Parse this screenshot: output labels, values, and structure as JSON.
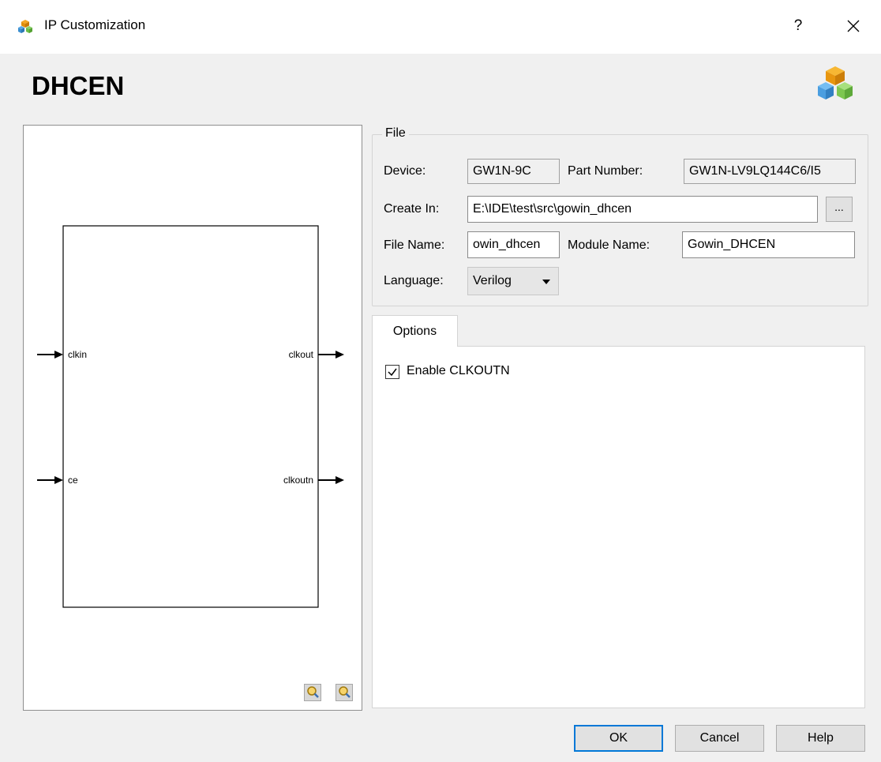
{
  "window": {
    "title": "IP Customization",
    "help_label": "?"
  },
  "heading": "DHCEN",
  "preview": {
    "ports_left": [
      "clkin",
      "ce"
    ],
    "ports_right": [
      "clkout",
      "clkoutn"
    ]
  },
  "file_group": {
    "title": "File",
    "device_label": "Device:",
    "device_value": "GW1N-9C",
    "part_number_label": "Part Number:",
    "part_number_value": "GW1N-LV9LQ144C6/I5",
    "create_in_label": "Create In:",
    "create_in_value": "E:\\IDE\\test\\src\\gowin_dhcen",
    "browse_label": "...",
    "file_name_label": "File Name:",
    "file_name_value": "owin_dhcen",
    "module_name_label": "Module Name:",
    "module_name_value": "Gowin_DHCEN",
    "language_label": "Language:",
    "language_value": "Verilog"
  },
  "options": {
    "tab_label": "Options",
    "enable_clkoutn_label": "Enable CLKOUTN",
    "enable_clkoutn_checked": true
  },
  "buttons": {
    "ok": "OK",
    "cancel": "Cancel",
    "help": "Help"
  }
}
